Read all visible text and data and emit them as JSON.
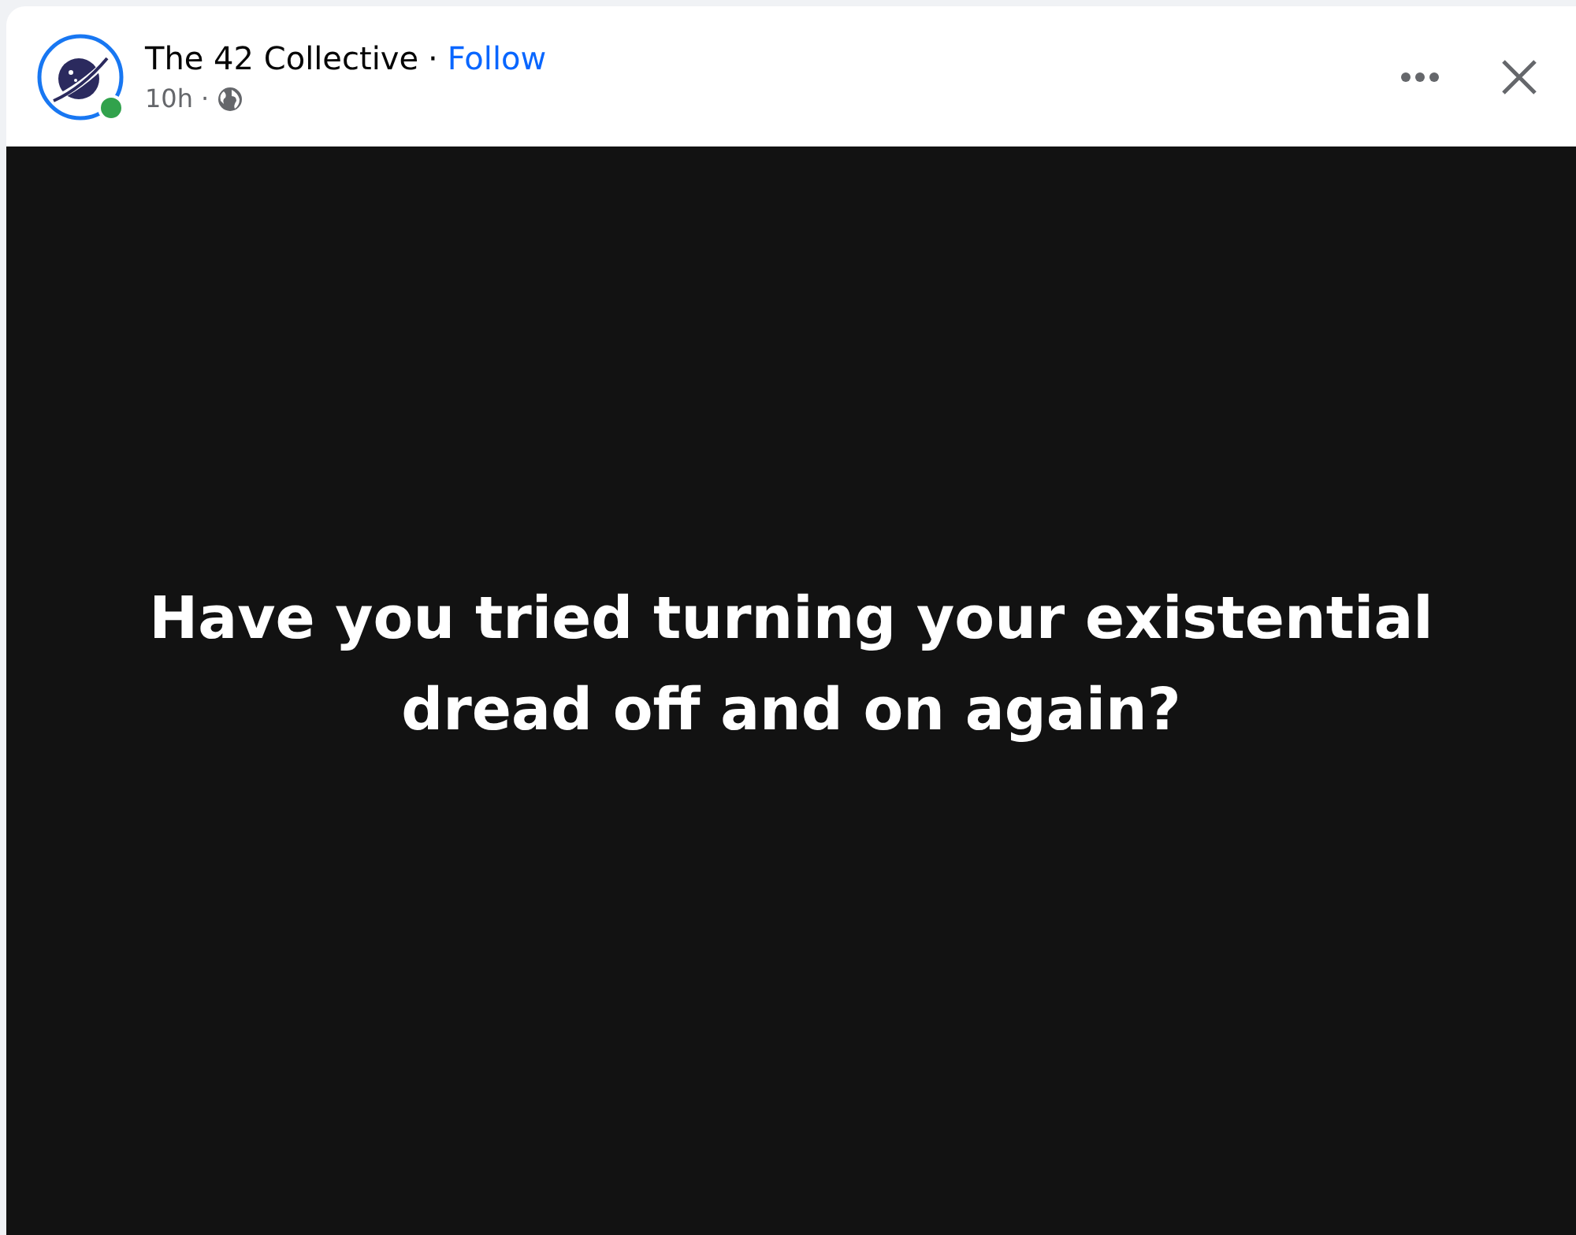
{
  "post": {
    "author": "The 42 Collective",
    "separator": "·",
    "follow_label": "Follow",
    "time": "10h",
    "time_separator": "·",
    "online": true,
    "text": "Have you tried turning your existential dread off and on again?"
  }
}
